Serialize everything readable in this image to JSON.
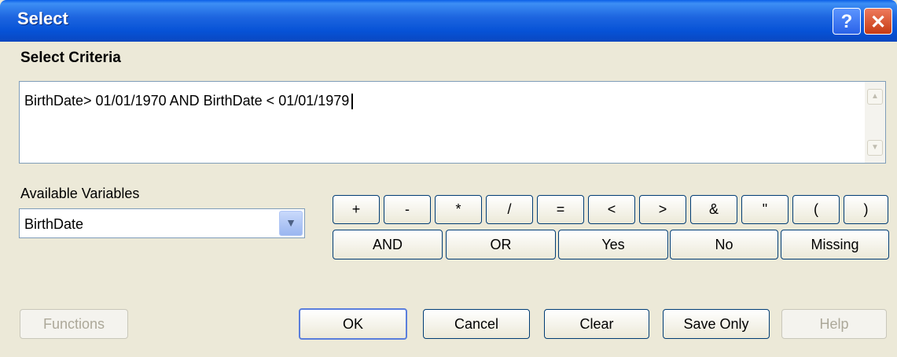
{
  "window": {
    "title": "Select",
    "help_label": "?",
    "close_label": "✕"
  },
  "criteria": {
    "label": "Select Criteria",
    "value": "BirthDate> 01/01/1970 AND BirthDate < 01/01/1979",
    "scroll_up": "▲",
    "scroll_down": "▼"
  },
  "variables": {
    "label": "Available Variables",
    "selected": "BirthDate",
    "dropdown_icon": "chevron-down-icon"
  },
  "operators": {
    "row1": [
      "+",
      "-",
      "*",
      "/",
      "=",
      "<",
      ">",
      "&",
      "\"",
      "(",
      ")"
    ],
    "row2": [
      "AND",
      "OR",
      "Yes",
      "No",
      "Missing"
    ]
  },
  "buttons": {
    "functions": "Functions",
    "ok": "OK",
    "cancel": "Cancel",
    "clear": "Clear",
    "save_only": "Save Only",
    "help": "Help"
  },
  "colors": {
    "titlebar": "#0a56d8",
    "face": "#ece9d8",
    "border": "#003c74",
    "input_border": "#7f9db9"
  }
}
